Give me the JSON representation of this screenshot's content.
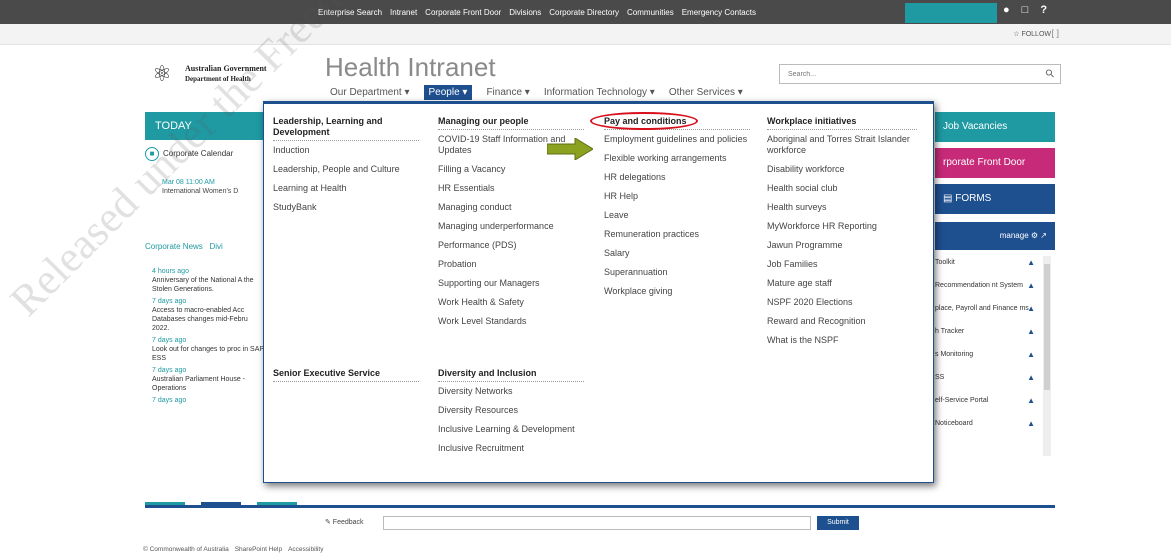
{
  "topbar": {
    "links": [
      "Enterprise Search",
      "Intranet",
      "Corporate Front Door",
      "Divisions",
      "Corporate Directory",
      "Communities",
      "Emergency Contacts"
    ],
    "icons": [
      "person-icon",
      "chat-icon",
      "help-icon"
    ]
  },
  "subbar": {
    "follow_label": "FOLLOW",
    "focus_label": "[ ]"
  },
  "logo": {
    "line1": "Australian Government",
    "line2": "Department of Health"
  },
  "site_title": "Health Intranet",
  "search": {
    "placeholder": "Search..."
  },
  "nav": {
    "items": [
      "Our Department ▾",
      "People ▾",
      "Finance ▾",
      "Information Technology ▾",
      "Other Services ▾"
    ]
  },
  "left": {
    "today": "TODAY",
    "calendar_label": "Corporate Calendar",
    "event_date": "Mar 08 11:00 AM",
    "event_title": "International Women's D",
    "tabs": [
      "Corporate News",
      "Divi"
    ],
    "news": [
      {
        "date": "4 hours ago",
        "text": "Anniversary of the National A the Stolen Generations."
      },
      {
        "date": "7 days ago",
        "text": "Access to macro-enabled Acc Databases changes mid-Febru 2022."
      },
      {
        "date": "7 days ago",
        "text": "Look out for changes to proc in SAP ESS"
      },
      {
        "date": "7 days ago",
        "text": "Australian Parliament House - Operations"
      },
      {
        "date": "7 days ago",
        "text": ""
      }
    ]
  },
  "right": {
    "jobs": "Job Vacancies",
    "cfd": "rporate Front Door",
    "forms": "FORMS",
    "manage": "manage",
    "tools": [
      "Toolkit",
      "Recommendation nt System",
      "place, Payroll and Finance ms",
      "h Tracker",
      "s Monitoring",
      "SS",
      "elf-Service Portal",
      "Noticeboard"
    ]
  },
  "mega": {
    "col1": {
      "heading": "Leadership, Learning and Development",
      "items": [
        "Induction",
        "Leadership, People and Culture",
        "Learning at Health",
        "StudyBank"
      ]
    },
    "col1b": {
      "heading": "Senior Executive Service",
      "items": []
    },
    "col2": {
      "heading": "Managing our people",
      "items": [
        "COVID-19 Staff Information and Updates",
        "Filling a Vacancy",
        "HR Essentials",
        "Managing conduct",
        "Managing underperformance",
        "Performance (PDS)",
        "Probation",
        "Supporting our Managers",
        "Work Health & Safety",
        "Work Level Standards"
      ]
    },
    "col2b": {
      "heading": "Diversity and Inclusion",
      "items": [
        "Diversity Networks",
        "Diversity Resources",
        "Inclusive Learning & Development",
        "Inclusive Recruitment"
      ]
    },
    "col3": {
      "heading": "Pay and conditions",
      "items": [
        "Employment guidelines and policies",
        "Flexible working arrangements",
        "HR delegations",
        "HR Help",
        "Leave",
        "Remuneration practices",
        "Salary",
        "Superannuation",
        "Workplace giving"
      ]
    },
    "col4": {
      "heading": "Workplace initiatives",
      "items": [
        "Aboriginal and Torres Strait Islander workforce",
        "Disability workforce",
        "Health social club",
        "Health surveys",
        "MyWorkforce HR Reporting",
        "Jawun Programme",
        "Job Families",
        "Mature age staff",
        "NSPF 2020 Elections",
        "Reward and Recognition",
        "What is the NSPF"
      ]
    }
  },
  "footer": {
    "feedback_label": "✎ Feedback",
    "submit_label": "Submit",
    "links": [
      "© Commonwealth of Australia",
      "SharePoint Help",
      "Accessibility"
    ]
  },
  "watermark": "Released under the Freedom of Information Act",
  "colors": {
    "teal": "#1f9aa3",
    "navy": "#1e4f8f",
    "magenta": "#c62a78",
    "annotation_red": "#d8101c",
    "arrow_green": "#8aa21f"
  }
}
